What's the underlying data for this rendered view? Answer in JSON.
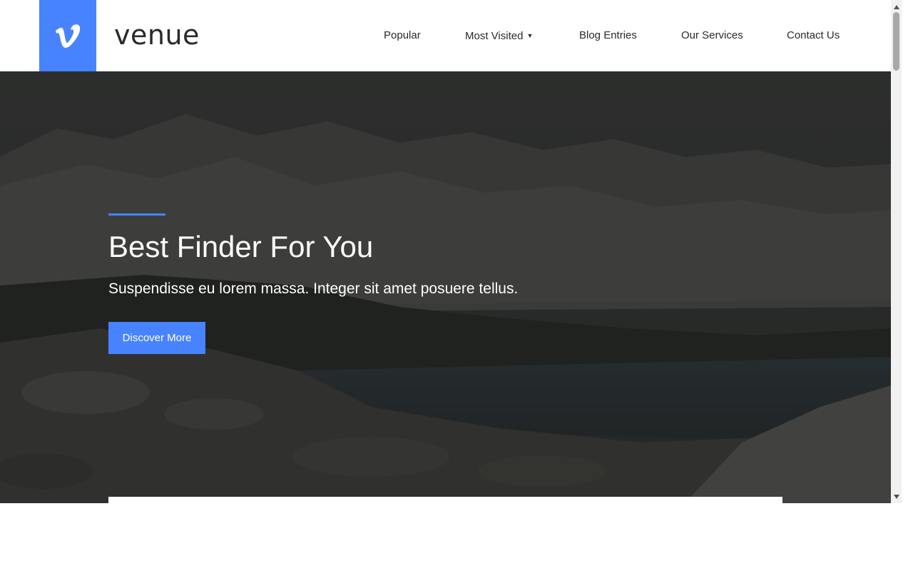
{
  "brand": {
    "name": "venue",
    "logo_icon": "vimeo-v-icon",
    "accent_color": "#4883ff"
  },
  "nav": {
    "items": [
      {
        "label": "Popular",
        "has_dropdown": false
      },
      {
        "label": "Most Visited",
        "has_dropdown": true,
        "dropdown_icon": "caret-down-icon"
      },
      {
        "label": "Blog Entries",
        "has_dropdown": false
      },
      {
        "label": "Our Services",
        "has_dropdown": false
      },
      {
        "label": "Contact Us",
        "has_dropdown": false
      }
    ]
  },
  "hero": {
    "title": "Best Finder For You",
    "subtitle": "Suspendisse eu lorem massa. Integer sit amet posuere tellus.",
    "button_label": "Discover More",
    "background": "mountain-lake-photo"
  },
  "scrollbar": {
    "up_icon": "scroll-up-arrow-icon",
    "down_icon": "scroll-down-arrow-icon"
  }
}
